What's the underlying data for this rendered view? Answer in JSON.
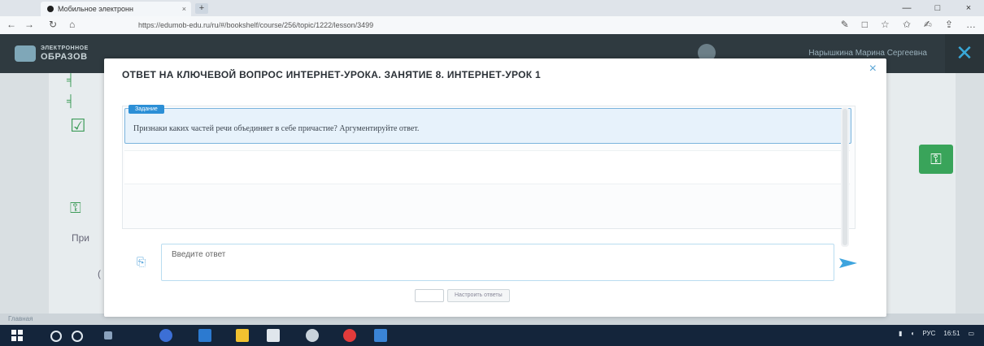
{
  "browser": {
    "tab_title": "Мобильное электронн",
    "tab_close": "×",
    "new_tab": "+",
    "url": "https://edumob-edu.ru/ru/#/bookshelf/course/256/topic/1222/lesson/3499",
    "window_controls": [
      "—",
      "□",
      "×"
    ],
    "nav": {
      "back": "←",
      "forward": "→",
      "refresh": "↻",
      "home": "⌂"
    },
    "toolbar_icons": [
      "✎",
      "□",
      "☆",
      "✩",
      "✍",
      "⇪",
      "…"
    ]
  },
  "site": {
    "logo_text_line1": "ЭЛЕКТРОННОЕ",
    "logo_text_line2": "ОБРАЗОВ",
    "user_name": "Нарышкина Марина Сергеевна",
    "close": "✕"
  },
  "background_page": {
    "partial_text": "При",
    "side_num": "("
  },
  "modal": {
    "title": "ОТВЕТ НА КЛЮЧЕВОЙ ВОПРОС ИНТЕРНЕТ-УРОКА. ЗАНЯТИЕ 8. ИНТЕРНЕТ-УРОК 1",
    "close": "×",
    "task_badge": "Задание",
    "task_text": "Признаки каких частей речи объединяет в себе причастие? Аргументируйте ответ.",
    "answer_placeholder": "Введите ответ",
    "send_icon": "send-arrow",
    "attach_icon": "attach-icon",
    "settings_label": "Настроить ответы"
  },
  "status_bar": {
    "text": "Главная"
  },
  "taskbar": {
    "time": "16:51",
    "lang": "РУС"
  }
}
